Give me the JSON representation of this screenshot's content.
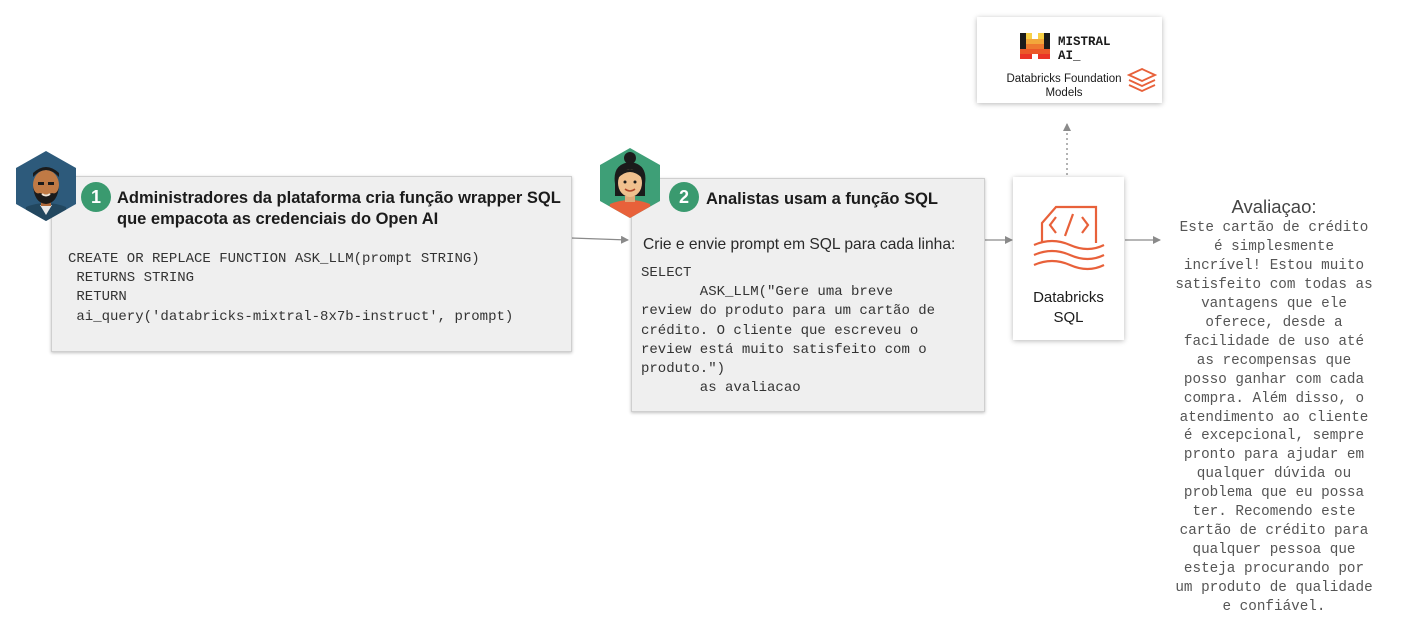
{
  "step1": {
    "number": "1",
    "title_line1": "Administradores da plataforma cria função wrapper SQL",
    "title_line2": "que empacota  as credenciais do Open AI",
    "code": "CREATE OR REPLACE FUNCTION ASK_LLM(prompt STRING)\n RETURNS STRING\n RETURN\n ai_query('databricks-mixtral-8x7b-instruct', prompt)"
  },
  "step2": {
    "number": "2",
    "title": "Analistas usam a função SQL",
    "subtitle": "Crie e envie prompt em SQL para cada linha:",
    "code": "SELECT\n       ASK_LLM(\"Gere uma breve\nreview do produto para um cartão de\ncrédito. O cliente que escreveu o\nreview está muito satisfeito com o\nproduto.\")\n       as avaliacao"
  },
  "model_card": {
    "brand": "MISTRAL\nAI_",
    "label": "Databricks Foundation\nModels"
  },
  "sql_card": {
    "label": "Databricks\nSQL"
  },
  "review": {
    "title": "Avaliaçao:",
    "text": "Este cartão de crédito\né simplesmente\nincrível! Estou muito\nsatisfeito com todas as\nvantagens que ele\noferece, desde a\nfacilidade de uso até\nas recompensas que\nposso ganhar com cada\ncompra. Além disso, o\natendimento ao cliente\né excepcional, sempre\npronto para ajudar em\nqualquer dúvida ou\nproblema que eu possa\nter. Recomendo este\ncartão de crédito para\nqualquer pessoa que\nesteja procurando por\num produto de qualidade\ne confiável."
  },
  "colors": {
    "step_badge": "#3a9a6f",
    "databricks_orange": "#e8613a",
    "mistral_orange": "#f7a51c",
    "admin_hex": "#2d5a7b",
    "analyst_hex": "#3e9f77"
  },
  "icons": {
    "admin_avatar": "bearded-man-avatar",
    "analyst_avatar": "woman-avatar",
    "mistral_logo": "mistral-logo",
    "databricks_logo": "databricks-stack-logo",
    "sql_icon": "code-sql-icon"
  }
}
